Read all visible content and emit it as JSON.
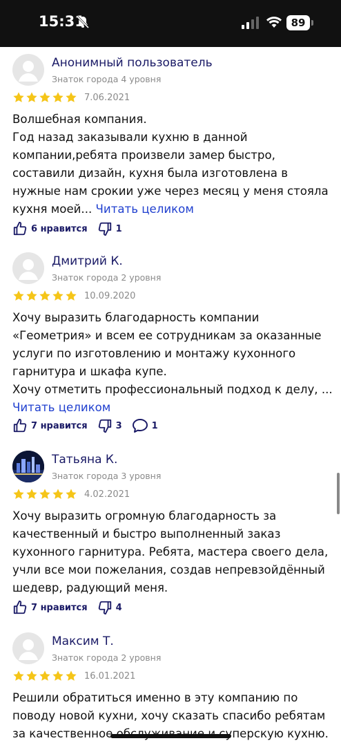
{
  "status_bar": {
    "time": "15:31",
    "battery": "89"
  },
  "colors": {
    "star": "#f5c518",
    "link": "#1f3fcf",
    "name": "#1a1a66"
  },
  "reviews": [
    {
      "author": "Анонимный пользователь",
      "level": "Знаток города 4 уровня",
      "rating": 5,
      "date": "7.06.2021",
      "text": "Волшебная компания.\nГод назад заказывали кухню в данной компании,ребята произвели замер быстро, составили дизайн, кухня была изготовлена в нужные нам срокии уже через месяц у меня стояла кухня моей...",
      "read_more": "Читать целиком",
      "likes": "6 нравится",
      "dislikes": "1",
      "comments": ""
    },
    {
      "author": "Дмитрий К.",
      "level": "Знаток города 2 уровня",
      "rating": 5,
      "date": "10.09.2020",
      "text": "Хочу выразить благодарность компании «Геометрия» и всем ее сотрудникам за оказанные услуги по изготовлению и монтажу кухонного гарнитура и шкафа купе.\nХочу отметить профессиональный подход к делу, ...",
      "read_more": "Читать целиком",
      "likes": "7 нравится",
      "dislikes": "3",
      "comments": "1"
    },
    {
      "author": "Татьяна К.",
      "level": "Знаток города 3 уровня",
      "rating": 5,
      "date": "4.02.2021",
      "text": "Хочу выразить огромную благодарность за качественный и быстро выполненный заказ кухонного гарнитура. Ребята, мастера своего дела, учли все мои пожелания, создав непревзойдённый шедевр, радующий меня.",
      "read_more": "",
      "likes": "7 нравится",
      "dislikes": "4",
      "comments": ""
    },
    {
      "author": "Максим Т.",
      "level": "Знаток города 2 уровня",
      "rating": 5,
      "date": "16.01.2021",
      "text": "Решили обратиться именно в эту компанию по поводу новой кухни, хочу сказать спасибо ребятам за качественное обслуживание и суперскую кухню.",
      "read_more": "",
      "likes": "",
      "dislikes": "",
      "comments": ""
    }
  ]
}
